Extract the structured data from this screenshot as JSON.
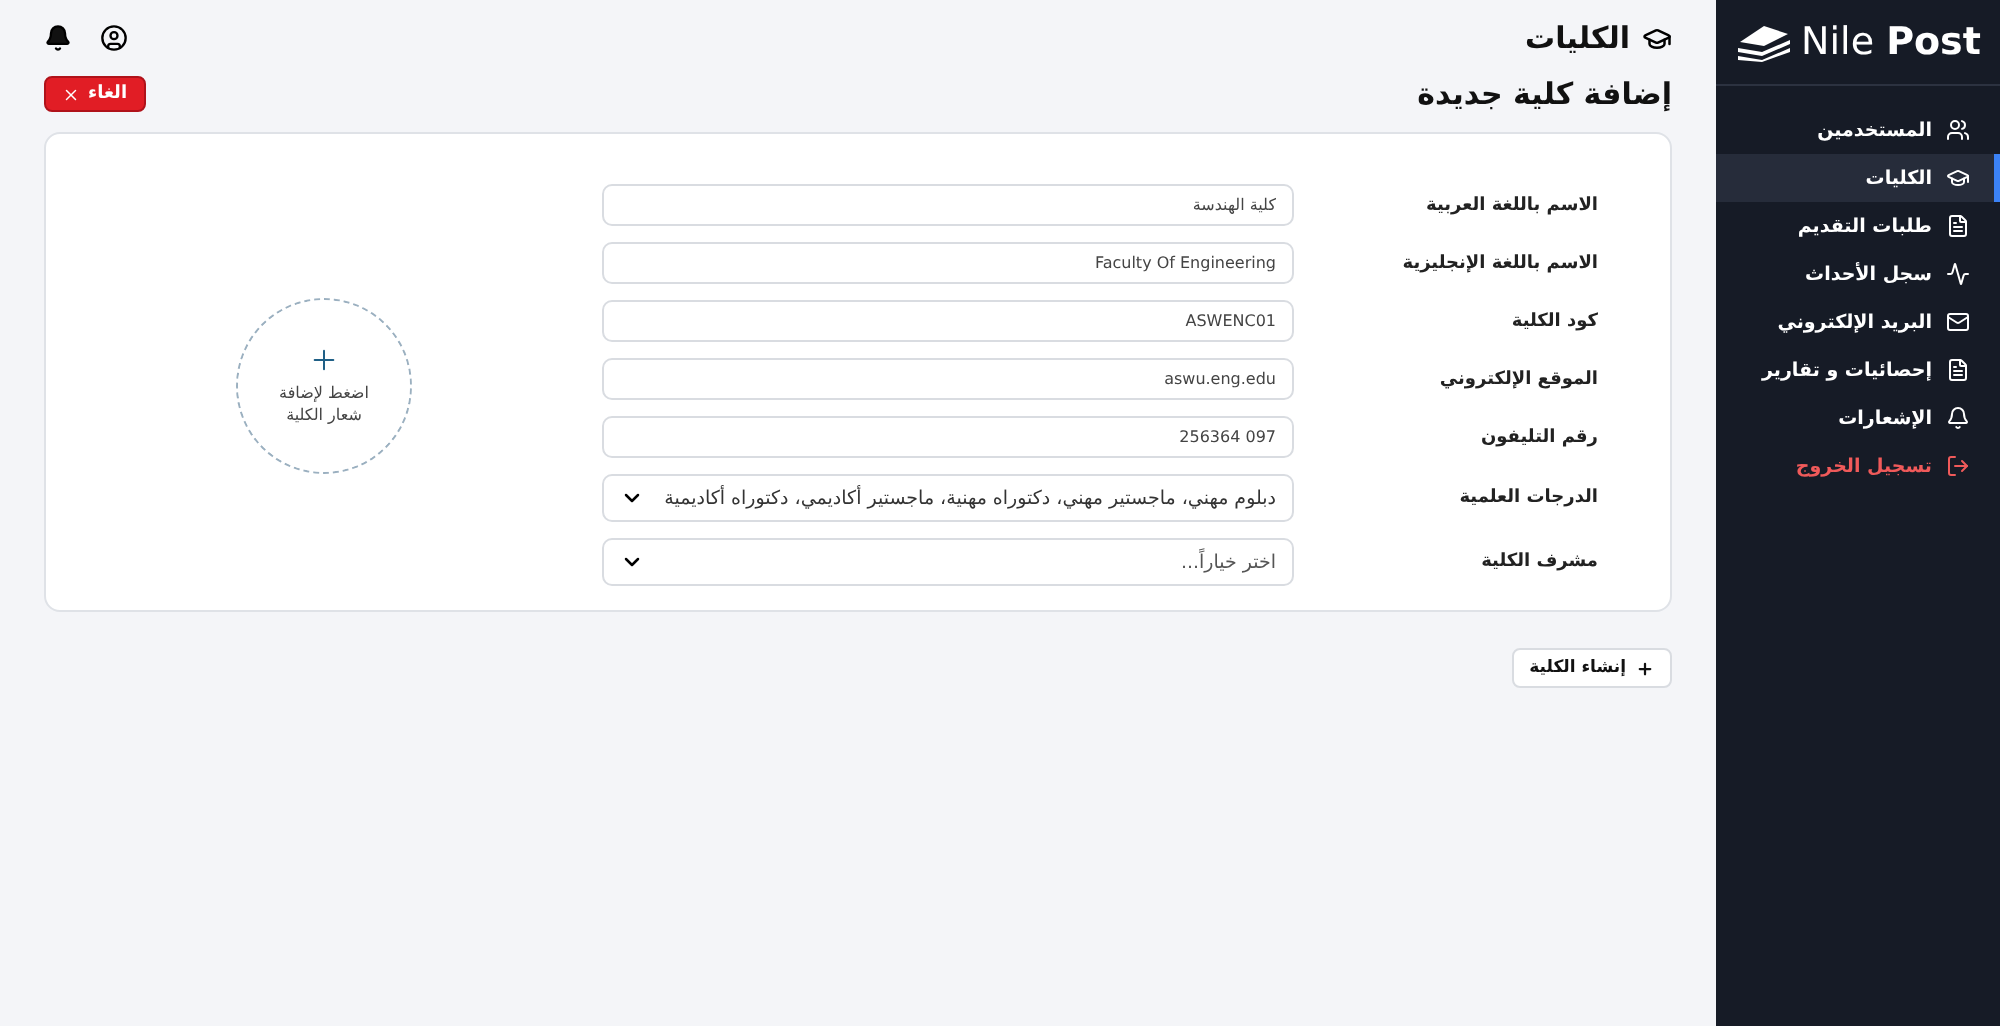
{
  "header": {
    "section_title": "الكليات",
    "page_title": "إضافة كلية جديدة",
    "cancel_button": "الغاء"
  },
  "form": {
    "fields": [
      {
        "label": "الاسم باللغة العربية",
        "kind": "input",
        "value": "كلية الهندسة"
      },
      {
        "label": "الاسم باللغة الإنجليزية",
        "kind": "input",
        "value": "Faculty Of Engineering"
      },
      {
        "label": "كود الكلية",
        "kind": "input",
        "value": "ASWENC01"
      },
      {
        "label": "الموقع الإلكتروني",
        "kind": "input",
        "value": "aswu.eng.edu"
      },
      {
        "label": "رقم التليفون",
        "kind": "input",
        "value": "256364 097"
      },
      {
        "label": "الدرجات العلمية",
        "kind": "select",
        "value": "دبلوم مهني، ماجستير مهني، دكتوراه مهنية، ماجستير أكاديمي، دكتوراه أكاديمية"
      },
      {
        "label": "مشرف الكلية",
        "kind": "select",
        "placeholder": "اختر خياراً..."
      }
    ],
    "logo_upload": "اضغط لإضافة شعار الكلية"
  },
  "create_button": "إنشاء الكلية",
  "sidebar": {
    "logo": {
      "light": "Nile",
      "bold": "Post"
    },
    "items": [
      {
        "label": "المستخدمين",
        "kind": "link",
        "selected": false
      },
      {
        "label": "الكليات",
        "kind": "link",
        "selected": true
      },
      {
        "label": "طلبات التقديم",
        "kind": "link",
        "selected": false
      },
      {
        "label": "سجل الأحداث",
        "kind": "link",
        "selected": false
      },
      {
        "label": "البريد الإلكتروني",
        "kind": "link",
        "selected": false
      },
      {
        "label": "إحصائيات و تقارير",
        "kind": "link",
        "selected": false
      },
      {
        "label": "الإشعارات",
        "kind": "link",
        "selected": false
      },
      {
        "label": "تسجيل الخروج",
        "kind": "logout",
        "selected": false
      }
    ]
  }
}
